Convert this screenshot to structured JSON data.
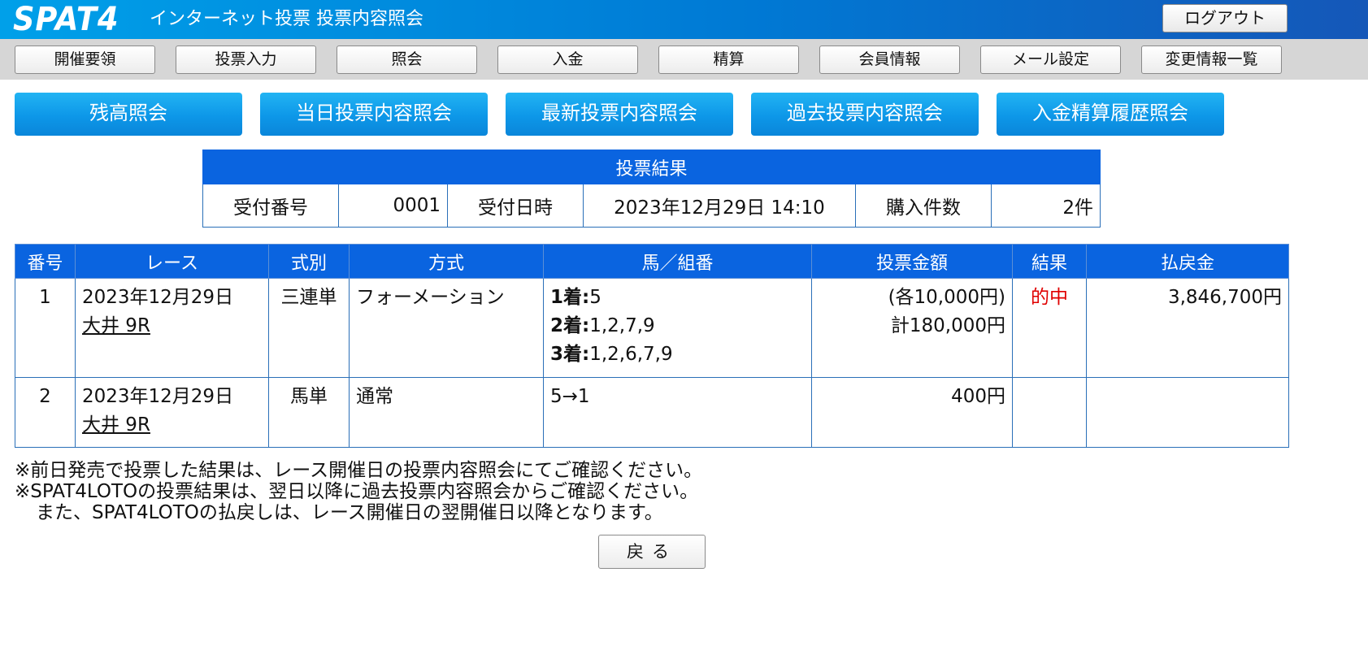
{
  "header": {
    "logo_text": "SPAT4",
    "title": "インターネット投票 投票内容照会",
    "logout_label": "ログアウト"
  },
  "nav": {
    "items": [
      "開催要領",
      "投票入力",
      "照会",
      "入金",
      "精算",
      "会員情報",
      "メール設定",
      "変更情報一覧"
    ]
  },
  "sections": {
    "items": [
      "残高照会",
      "当日投票内容照会",
      "最新投票内容照会",
      "過去投票内容照会",
      "入金精算履歴照会"
    ]
  },
  "summary": {
    "title": "投票結果",
    "receipt_no_label": "受付番号",
    "receipt_no": "0001",
    "receipt_datetime_label": "受付日時",
    "receipt_datetime": "2023年12月29日 14:10",
    "count_label": "購入件数",
    "count": "2件"
  },
  "results": {
    "headers": [
      "番号",
      "レース",
      "式別",
      "方式",
      "馬／組番",
      "投票金額",
      "結果",
      "払戻金"
    ],
    "rows": [
      {
        "no": "1",
        "date": "2023年12月29日",
        "race": "大井 9R",
        "type": "三連単",
        "method": "フォーメーション",
        "combo": [
          {
            "label": "1着:",
            "value": "5"
          },
          {
            "label": "2着:",
            "value": "1,2,7,9"
          },
          {
            "label": "3着:",
            "value": "1,2,6,7,9"
          }
        ],
        "amount_each": "(各10,000円)",
        "amount_total": "計180,000円",
        "result": "的中",
        "payout": "3,846,700円"
      },
      {
        "no": "2",
        "date": "2023年12月29日",
        "race": "大井 9R",
        "type": "馬単",
        "method": "通常",
        "combo_text": "5→1",
        "amount": "400円",
        "result": "",
        "payout": ""
      }
    ]
  },
  "notes": {
    "line1": "※前日発売で投票した結果は、レース開催日の投票内容照会にてご確認ください。",
    "line2": "※SPAT4LOTOの投票結果は、翌日以降に過去投票内容照会からご確認ください。",
    "line3": "また、SPAT4LOTOの払戻しは、レース開催日の翌開催日以降となります。"
  },
  "back_label": "戻る",
  "colors": {
    "header_gradient_start": "#00a0e9",
    "header_gradient_end": "#1557b8",
    "table_header": "#0a64e0",
    "section_button": "#0d97e8",
    "hit_text": "#e00000"
  }
}
